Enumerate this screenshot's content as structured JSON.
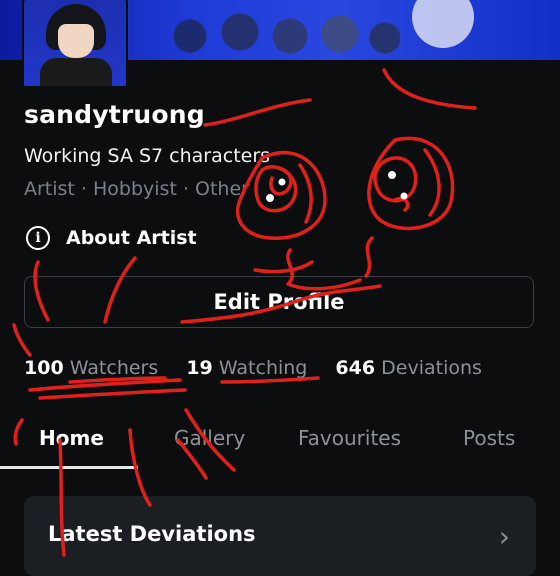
{
  "profile": {
    "username": "sandytruong",
    "tagline": "Working SA S7 characters",
    "roles": "Artist · Hobbyist · Other"
  },
  "about": {
    "label": "About Artist",
    "icon": "info-icon"
  },
  "edit_profile_label": "Edit Profile",
  "stats": [
    {
      "count": "100",
      "label": "Watchers"
    },
    {
      "count": "19",
      "label": "Watching"
    },
    {
      "count": "646",
      "label": "Deviations"
    }
  ],
  "tabs": [
    {
      "label": "Home",
      "active": true
    },
    {
      "label": "Gallery",
      "active": false
    },
    {
      "label": "Favourites",
      "active": false
    },
    {
      "label": "Posts",
      "active": false
    }
  ],
  "section": {
    "title": "Latest Deviations",
    "icon": "chevron-right-icon"
  },
  "colors": {
    "background": "#0b0d0f",
    "banner": "#1f3bd8",
    "scribble": "#e0201b",
    "muted": "#8d9198"
  }
}
